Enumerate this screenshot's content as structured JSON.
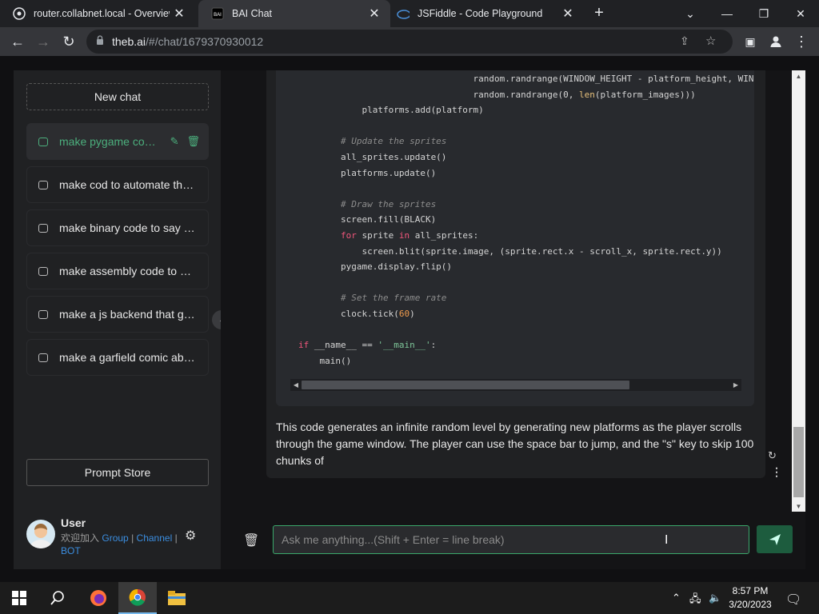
{
  "browser": {
    "tabs": [
      {
        "title": "router.collabnet.local - Overview",
        "favicon": "router-icon",
        "active": false
      },
      {
        "title": "BAI Chat",
        "favicon": "bai-icon",
        "active": true
      },
      {
        "title": "JSFiddle - Code Playground",
        "favicon": "jsfiddle-icon",
        "active": false
      }
    ],
    "url_host": "theb.ai",
    "url_path": "/#/chat/1679370930012"
  },
  "sidebar": {
    "new_chat": "New chat",
    "items": [
      {
        "label": "make pygame code..."
      },
      {
        "label": "make cod to automate the..."
      },
      {
        "label": "make binary code to say h..."
      },
      {
        "label": "make assembly code to ge..."
      },
      {
        "label": "make a js backend that ge..."
      },
      {
        "label": "make a garfield comic abo..."
      }
    ],
    "prompt_store": "Prompt Store",
    "user": {
      "name": "User",
      "join_text": "欢迎加入",
      "group": "Group",
      "channel": "Channel",
      "bot": "BOT",
      "sep": "|"
    }
  },
  "chat": {
    "code_lines": [
      "                                 random.randrange(WINDOW_HEIGHT - platform_height, WIN",
      "                                 random.randrange(0, len(platform_images)))",
      "            platforms.add(platform)",
      "",
      "        # Update the sprites",
      "        all_sprites.update()",
      "        platforms.update()",
      "",
      "        # Draw the sprites",
      "        screen.fill(BLACK)",
      "        for sprite in all_sprites:",
      "            screen.blit(sprite.image, (sprite.rect.x - scroll_x, sprite.rect.y))",
      "        pygame.display.flip()",
      "",
      "        # Set the frame rate",
      "        clock.tick(60)",
      "",
      "if __name__ == '__main__':",
      "    main()"
    ],
    "message_text": "This code generates an infinite random level by generating new platforms as the player scrolls through the game window. The player can use the space bar to jump, and the \"s\" key to skip 100 chunks of",
    "input_placeholder": "Ask me anything...(Shift + Enter = line break)"
  },
  "taskbar": {
    "time": "8:57 PM",
    "date": "3/20/2023"
  },
  "colors": {
    "accent": "#4caf7d",
    "link": "#3b8ee0"
  }
}
